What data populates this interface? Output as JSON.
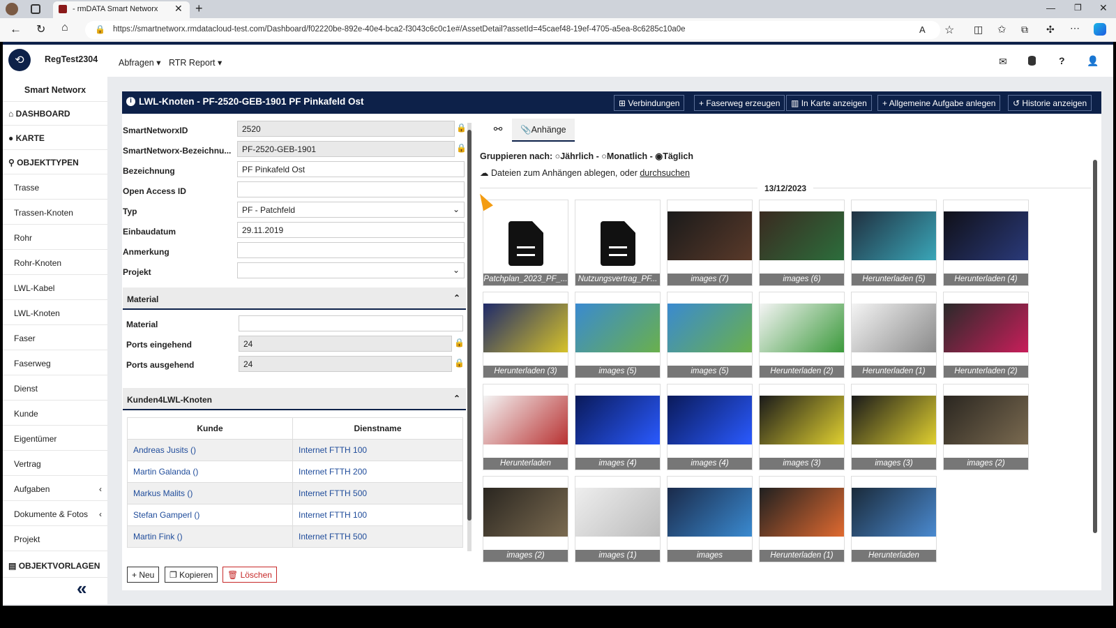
{
  "browser": {
    "tab_title": "- rmDATA Smart Networx",
    "url": "https://smartnetworx.rmdatacloud-test.com/Dashboard/f02220be-892e-40e4-bca2-f3043c6c0c1e#/AssetDetail?assetId=45caef48-19ef-4705-a5ea-8c6285c10a0e"
  },
  "app": {
    "tenant": "RegTest2304",
    "menu": [
      "Abfragen",
      "RTR Report"
    ]
  },
  "sidebar": {
    "title": "Smart Networx",
    "items": [
      "DASHBOARD",
      "KARTE",
      "OBJEKTTYPEN",
      "Trasse",
      "Trassen-Knoten",
      "Rohr",
      "Rohr-Knoten",
      "LWL-Kabel",
      "LWL-Knoten",
      "Faser",
      "Faserweg",
      "Dienst",
      "Kunde",
      "Eigentümer",
      "Vertrag",
      "Aufgaben",
      "Dokumente & Fotos",
      "Projekt",
      "OBJEKTVORLAGEN"
    ]
  },
  "panel": {
    "title": "LWL-Knoten - PF-2520-GEB-1901 PF Pinkafeld Ost",
    "actions": [
      "Verbindungen",
      "+ Faserweg erzeugen",
      "In Karte anzeigen",
      "+ Allgemeine Aufgabe anlegen",
      "Historie anzeigen"
    ]
  },
  "form": {
    "fields": [
      {
        "label": "SmartNetworxID",
        "value": "2520",
        "readonly": true
      },
      {
        "label": "SmartNetworx-Bezeichnu...",
        "value": "PF-2520-GEB-1901",
        "readonly": true
      },
      {
        "label": "Bezeichnung",
        "value": "PF Pinkafeld Ost"
      },
      {
        "label": "Open Access ID",
        "value": ""
      },
      {
        "label": "Typ",
        "value": "PF - Patchfeld",
        "select": true
      },
      {
        "label": "Einbaudatum",
        "value": "29.11.2019"
      },
      {
        "label": "Anmerkung",
        "value": ""
      },
      {
        "label": "Projekt",
        "value": "",
        "select": true
      }
    ],
    "material_section": "Material",
    "material_fields": [
      {
        "label": "Material",
        "value": ""
      },
      {
        "label": "Ports eingehend",
        "value": "24",
        "readonly": true
      },
      {
        "label": "Ports ausgehend",
        "value": "24",
        "readonly": true
      }
    ],
    "kunden_section": "Kunden4LWL-Knoten",
    "kunden_headers": [
      "Kunde",
      "Dienstname"
    ],
    "kunden_rows": [
      [
        "Andreas Jusits ()",
        "Internet FTTH 100"
      ],
      [
        "Martin Galanda ()",
        "Internet FTTH 200"
      ],
      [
        "Markus Malits ()",
        "Internet FTTH 500"
      ],
      [
        "Stefan Gamperl ()",
        "Internet FTTH 100"
      ],
      [
        "Martin Fink ()",
        "Internet FTTH 500"
      ]
    ],
    "buttons": [
      "+ Neu",
      "Kopieren",
      "Löschen"
    ]
  },
  "attachments": {
    "tab": "Anhänge",
    "group_label": "Gruppieren nach:",
    "group_options": [
      "Jährlich",
      "Monatlich",
      "Täglich"
    ],
    "group_selected": "Täglich",
    "upload_text": "Dateien zum Anhängen ablegen, oder",
    "upload_link": "durchsuchen",
    "date": "13/12/2023",
    "tiles": [
      "Patchplan_2023_PF_...",
      "Nutzungsvertrag_PF...",
      "images (7)",
      "images (6)",
      "Herunterladen (5)",
      "Herunterladen (4)",
      "Herunterladen (3)",
      "images (5)",
      "images (5)",
      "Herunterladen (2)",
      "Herunterladen (1)",
      "Herunterladen (2)",
      "Herunterladen",
      "images (4)",
      "images (4)",
      "images (3)",
      "images (3)",
      "images (2)",
      "images (2)",
      "images (1)",
      "images",
      "Herunterladen (1)",
      "Herunterladen"
    ]
  },
  "colors": {
    "navy": "#0d2149",
    "link": "#1e4b9a",
    "delete": "#c62828"
  }
}
